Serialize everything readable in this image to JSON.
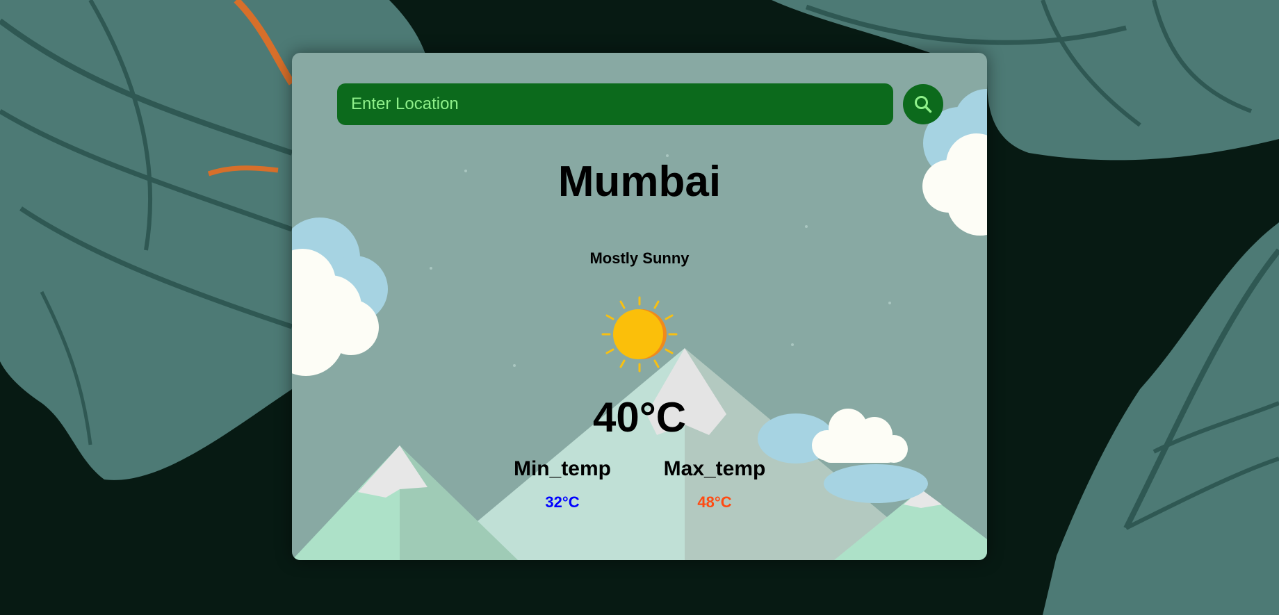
{
  "search": {
    "placeholder": "Enter Location",
    "button_icon": "search-icon"
  },
  "weather": {
    "city": "Mumbai",
    "condition": "Mostly Sunny",
    "condition_icon": "sun-icon",
    "temperature": "40°C",
    "min_label": "Min_temp",
    "min_value": "32°C",
    "max_label": "Max_temp",
    "max_value": "48°C"
  },
  "colors": {
    "page_background": "#071a13",
    "search_background": "#0c6a1c",
    "search_text": "#8ff08a",
    "min_value": "#0000ff",
    "max_value": "#ff4a12"
  }
}
